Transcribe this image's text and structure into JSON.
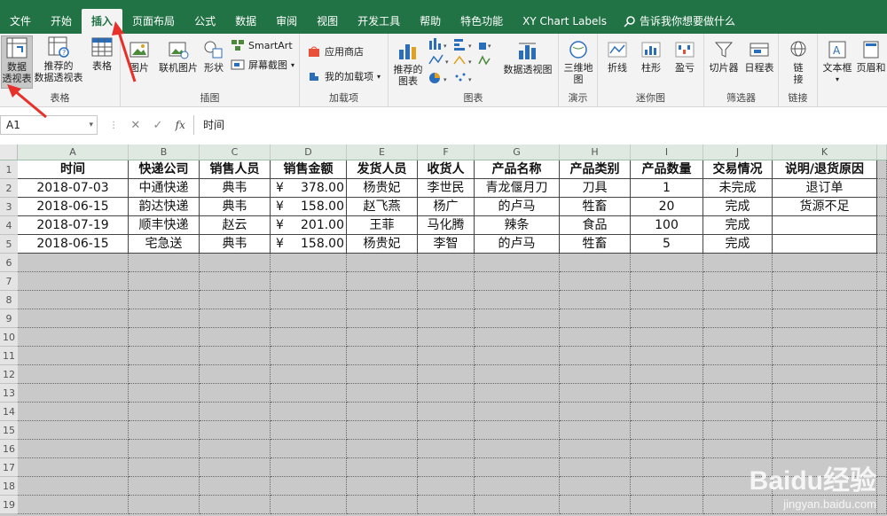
{
  "tabs": [
    "文件",
    "开始",
    "插入",
    "页面布局",
    "公式",
    "数据",
    "审阅",
    "视图",
    "开发工具",
    "帮助",
    "特色功能",
    "XY Chart Labels"
  ],
  "active_tab": "插入",
  "tell_me": "告诉我你想要做什么",
  "ribbon": {
    "tables": {
      "label": "表格",
      "pivot": "数据\n透视表",
      "recommended_pivot": "推荐的\n数据透视表",
      "table": "表格"
    },
    "illustrations": {
      "label": "插图",
      "picture": "图片",
      "online_picture": "联机图片",
      "shapes": "形状",
      "smartart": "SmartArt",
      "screenshot": "屏幕截图"
    },
    "addins": {
      "label": "加载项",
      "store": "应用商店",
      "my_addins": "我的加载项"
    },
    "charts": {
      "label": "图表",
      "recommended": "推荐的\n图表",
      "pivot_chart": "数据透视图"
    },
    "tours": {
      "label": "演示",
      "map3d": "三维地\n图"
    },
    "sparklines": {
      "label": "迷你图",
      "line": "折线",
      "column": "柱形",
      "winloss": "盈亏"
    },
    "filters": {
      "label": "筛选器",
      "slicer": "切片器",
      "timeline": "日程表"
    },
    "links": {
      "label": "链接",
      "link": "链\n接"
    },
    "text": {
      "textbox": "文本框",
      "header_footer": "页眉和"
    }
  },
  "formula_bar": {
    "name_box": "A1",
    "fx": "fx",
    "value": "时间"
  },
  "columns": [
    "A",
    "B",
    "C",
    "D",
    "E",
    "F",
    "G",
    "H",
    "I",
    "J",
    "K"
  ],
  "rows": [
    "1",
    "2",
    "3",
    "4",
    "5",
    "6",
    "7",
    "8",
    "9",
    "10",
    "11",
    "12",
    "13",
    "14",
    "15",
    "16",
    "17",
    "18",
    "19"
  ],
  "table": {
    "headers": [
      "时间",
      "快递公司",
      "销售人员",
      "销售金额",
      "发货人员",
      "收货人",
      "产品名称",
      "产品类别",
      "产品数量",
      "交易情况",
      "说明/退货原因"
    ],
    "records": [
      [
        "2018-07-03",
        "中通快递",
        "典韦",
        "378.00",
        "杨贵妃",
        "李世民",
        "青龙偃月刀",
        "刀具",
        "1",
        "未完成",
        "退订单"
      ],
      [
        "2018-06-15",
        "韵达快递",
        "典韦",
        "158.00",
        "赵飞燕",
        "杨广",
        "的卢马",
        "牲畜",
        "20",
        "完成",
        "货源不足"
      ],
      [
        "2018-07-19",
        "顺丰快递",
        "赵云",
        "201.00",
        "王菲",
        "马化腾",
        "辣条",
        "食品",
        "100",
        "完成",
        ""
      ],
      [
        "2018-06-15",
        "宅急送",
        "典韦",
        "158.00",
        "杨贵妃",
        "李智",
        "的卢马",
        "牲畜",
        "5",
        "完成",
        ""
      ]
    ],
    "currency_symbol": "¥"
  },
  "watermark": {
    "brand": "Baidu经验",
    "url": "jingyan.baidu.com"
  },
  "colors": {
    "excel_green": "#217346",
    "selection_gray": "#c9c9c9",
    "arrow_red": "#e8302a"
  }
}
